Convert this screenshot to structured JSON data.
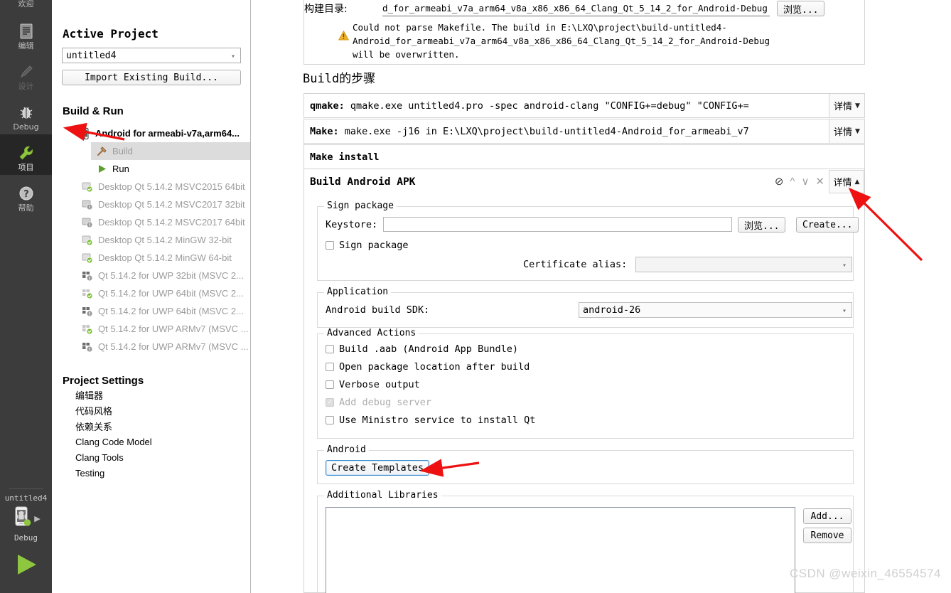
{
  "modebar": {
    "items": [
      {
        "label": "欢迎",
        "icon": "welcome-icon",
        "state": "normal"
      },
      {
        "label": "编辑",
        "icon": "edit-document-icon",
        "state": "normal"
      },
      {
        "label": "设计",
        "icon": "pencil-design-icon",
        "state": "disabled"
      },
      {
        "label": "Debug",
        "icon": "bug-icon",
        "state": "normal"
      },
      {
        "label": "项目",
        "icon": "wrench-icon",
        "state": "active"
      },
      {
        "label": "帮助",
        "icon": "question-help-icon",
        "state": "normal"
      }
    ],
    "kit_selector": {
      "project": "untitled4",
      "build_config": "Debug",
      "icon": "android-device-icon",
      "arrow": "play-right-small"
    },
    "run_button": "run-play-icon"
  },
  "project_panel": {
    "active_project_title": "Active Project",
    "project_combo_value": "untitled4",
    "import_button": "Import Existing Build...",
    "build_run_title": "Build & Run",
    "kits": [
      {
        "label": "Android for armeabi-v7a,arm64...",
        "type": "head",
        "icon": "android-kit-icon"
      },
      {
        "label": "Build",
        "type": "child-selected",
        "icon": "hammer-icon"
      },
      {
        "label": "Run",
        "type": "child",
        "icon": "play-icon"
      },
      {
        "label": "Desktop Qt 5.14.2 MSVC2015 64bit",
        "type": "kit",
        "icon": "desktop-ok-icon"
      },
      {
        "label": "Desktop Qt 5.14.2 MSVC2017 32bit",
        "type": "kit",
        "icon": "desktop-warn-icon"
      },
      {
        "label": "Desktop Qt 5.14.2 MSVC2017 64bit",
        "type": "kit",
        "icon": "desktop-warn-icon"
      },
      {
        "label": "Desktop Qt 5.14.2 MinGW 32-bit",
        "type": "kit",
        "icon": "desktop-ok-icon"
      },
      {
        "label": "Desktop Qt 5.14.2 MinGW 64-bit",
        "type": "kit",
        "icon": "desktop-ok-icon"
      },
      {
        "label": "Qt 5.14.2 for UWP 32bit (MSVC 2...",
        "type": "kit",
        "icon": "uwp-warn-icon"
      },
      {
        "label": "Qt 5.14.2 for UWP 64bit (MSVC 2...",
        "type": "kit",
        "icon": "uwp-ok-icon"
      },
      {
        "label": "Qt 5.14.2 for UWP 64bit (MSVC 2...",
        "type": "kit",
        "icon": "uwp-warn-icon"
      },
      {
        "label": "Qt 5.14.2 for UWP ARMv7 (MSVC ...",
        "type": "kit",
        "icon": "uwp-ok-icon"
      },
      {
        "label": "Qt 5.14.2 for UWP ARMv7 (MSVC ...",
        "type": "kit",
        "icon": "uwp-warn-icon"
      }
    ],
    "project_settings_title": "Project Settings",
    "settings": [
      "编辑器",
      "代码风格",
      "依赖关系",
      "Clang Code Model",
      "Clang Tools",
      "Testing"
    ]
  },
  "build_dir": {
    "label": "构建目录:",
    "value": "d_for_armeabi_v7a_arm64_v8a_x86_x86_64_Clang_Qt_5_14_2_for_Android-Debug",
    "browse_button": "浏览...",
    "warning_icon": "warning-triangle-icon",
    "warning_lines": [
      "Could not parse Makefile. The build in E:\\LXQ\\project\\build-untitled4-",
      "Android_for_armeabi_v7a_arm64_v8a_x86_x86_64_Clang_Qt_5_14_2_for_Android-Debug",
      "will be overwritten."
    ]
  },
  "build_steps": {
    "section_title": "Build的步骤",
    "detail_label": "详情",
    "steps": [
      {
        "name": "qmake:",
        "command": "qmake.exe untitled4.pro -spec android-clang \"CONFIG+=debug\" \"CONFIG+=",
        "has_detail": true,
        "expanded": false
      },
      {
        "name": "Make:",
        "command": "make.exe -j16 in E:\\LXQ\\project\\build-untitled4-Android_for_armeabi_v7",
        "has_detail": true,
        "expanded": false
      },
      {
        "name": "Make install",
        "command": "",
        "has_detail": false,
        "expanded": false
      }
    ],
    "apk_step": {
      "title": "Build Android APK",
      "detail_label": "详情",
      "tools": [
        {
          "icon": "disable-step-icon",
          "enabled": true
        },
        {
          "icon": "move-up-icon",
          "enabled": false
        },
        {
          "icon": "move-down-icon",
          "enabled": false
        },
        {
          "icon": "remove-step-icon",
          "enabled": false
        }
      ],
      "expanded": true
    }
  },
  "apk_form": {
    "sign_package": {
      "legend": "Sign package",
      "keystore_label": "Keystore:",
      "keystore_value": "",
      "browse_button": "浏览...",
      "create_button": "Create...",
      "sign_checkbox": {
        "label": "Sign package",
        "checked": false
      },
      "cert_alias_label": "Certificate alias:",
      "cert_alias_value": "",
      "cert_alias_disabled": true
    },
    "application": {
      "legend": "Application",
      "sdk_label": "Android build SDK:",
      "sdk_value": "android-26"
    },
    "advanced_actions": {
      "legend": "Advanced Actions",
      "checkboxes": [
        {
          "label": "Build .aab (Android App Bundle)",
          "checked": false,
          "disabled": false
        },
        {
          "label": "Open package location after build",
          "checked": false,
          "disabled": false
        },
        {
          "label": "Verbose output",
          "checked": false,
          "disabled": false
        },
        {
          "label": "Add debug server",
          "checked": true,
          "disabled": true
        },
        {
          "label": "Use Ministro service to install Qt",
          "checked": false,
          "disabled": false
        }
      ]
    },
    "android": {
      "legend": "Android",
      "create_templates_button": "Create Templates"
    },
    "additional_libraries": {
      "legend": "Additional Libraries",
      "items": [],
      "add_button": "Add...",
      "remove_button": "Remove"
    }
  },
  "annotations": {
    "watermark": "CSDN @weixin_46554574",
    "arrow_color": "#ee1111",
    "arrows": [
      {
        "name": "arrow-to-projects-mode",
        "from": [
          175,
          196
        ],
        "to": [
          84,
          179
        ]
      },
      {
        "name": "arrow-to-detail-button",
        "from": [
          1297,
          366
        ],
        "to": [
          1192,
          264
        ]
      },
      {
        "name": "arrow-to-create-templates",
        "from": [
          674,
          651
        ],
        "to": [
          589,
          662
        ]
      }
    ]
  }
}
